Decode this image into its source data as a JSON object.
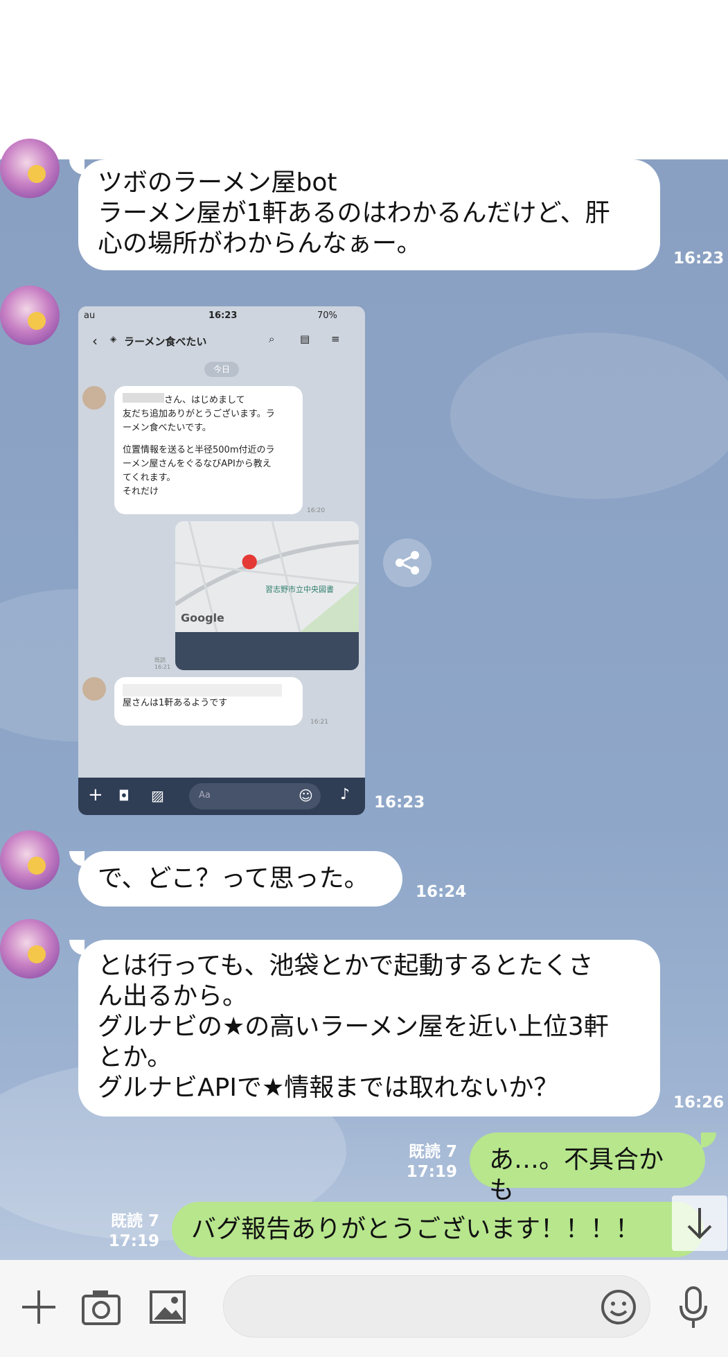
{
  "messages": {
    "m1": {
      "text_lines": [
        "ツボのラーメン屋bot",
        "ラーメン屋が1軒あるのはわかるんだけど、肝",
        "心の場所がわからんなぁー。"
      ],
      "time": "16:23"
    },
    "m2": {
      "time": "16:23"
    },
    "m3": {
      "text": "で、どこ？って思った。",
      "time": "16:24"
    },
    "m4": {
      "text_lines": [
        "とは行っても、池袋とかで起動するとたくさ",
        "ん出るから。",
        "グルナビの★の高いラーメン屋を近い上位3軒",
        "とか。",
        "グルナビAPIで★情報までは取れないか？"
      ],
      "time": "16:26"
    },
    "m5": {
      "text": "あ…。不具合かも",
      "read": "既読 7",
      "time": "17:19"
    },
    "m6": {
      "text": "バグ報告ありがとうございます！！！！",
      "read": "既読 7",
      "time": "17:19"
    }
  },
  "screenshot": {
    "status_carrier": "au",
    "status_time": "16:23",
    "status_battery": "70%",
    "title": "ラーメン食べたい",
    "date_chip": "今日",
    "bot_msg_line1": "さん、はじめまして",
    "bot_msg_line2": "友だち追加ありがとうございます。ラ",
    "bot_msg_line3": "ーメン食べたいです。",
    "bot_msg_line4": "位置情報を送ると半径500m付近のラ",
    "bot_msg_line5": "ーメン屋さんをぐるなびAPIから教え",
    "bot_msg_line6": "てくれます。",
    "bot_msg_line7": "それだけ",
    "bot_msg_time": "16:20",
    "map_label": "習志野市立中央図書",
    "map_brand": "Google",
    "read_small": "既読",
    "read_small_time": "16:21",
    "bot_reply_line2": "屋さんは1軒あるようです",
    "bot_reply_time": "16:21",
    "input_placeholder": "Aa"
  },
  "composer": {
    "placeholder": ""
  }
}
